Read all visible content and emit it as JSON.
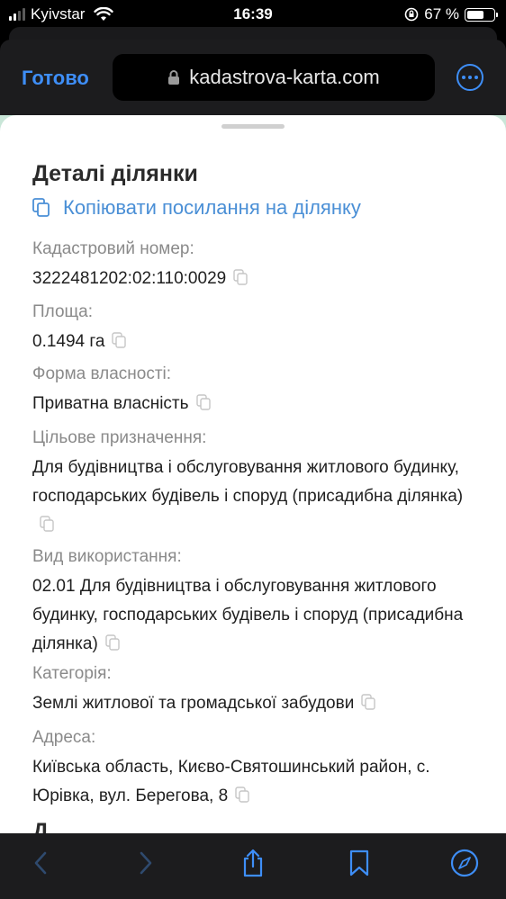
{
  "status_bar": {
    "carrier": "Kyivstar",
    "time": "16:39",
    "battery_percent": "67 %",
    "battery_level": 0.67
  },
  "header": {
    "done_label": "Готово",
    "url": "kadastrova-karta.com"
  },
  "card": {
    "title": "Деталі ділянки",
    "copy_link_label": "Копіювати посилання на ділянку",
    "fields": [
      {
        "label": "Кадастровий номер:",
        "value": "3222481202:02:110:0029"
      },
      {
        "label": "Площа:",
        "value": "0.1494 га"
      },
      {
        "label": "Форма власності:",
        "value": "Приватна власність"
      },
      {
        "label": "Цільове призначення:",
        "value": "Для будівництва і обслуговування житлового будинку, господарських будівель і споруд (присадибна ділянка)"
      },
      {
        "label": "Вид використання:",
        "value": "02.01 Для будівництва і обслуговування житлового будинку, господарських будівель і споруд (присадибна ділянка)"
      },
      {
        "label": "Категорія:",
        "value": "Землі житлової та громадської забудови"
      },
      {
        "label": "Адреса:",
        "value": "Київська область, Києво-Святошинський район, с. Юрівка, вул. Берегова, 8"
      }
    ],
    "next_heading": "Д..."
  },
  "colors": {
    "accent": "#3e8ef7",
    "link": "#4a8fd6",
    "label_gray": "#8a8a8a",
    "map_underlay": "#c9e6d8"
  },
  "icons": [
    "signal-icon",
    "wifi-icon",
    "orientation-lock-icon",
    "battery-icon",
    "lock-icon",
    "more-icon",
    "copy-icon",
    "back-icon",
    "forward-icon",
    "share-icon",
    "bookmark-icon",
    "compass-icon"
  ]
}
